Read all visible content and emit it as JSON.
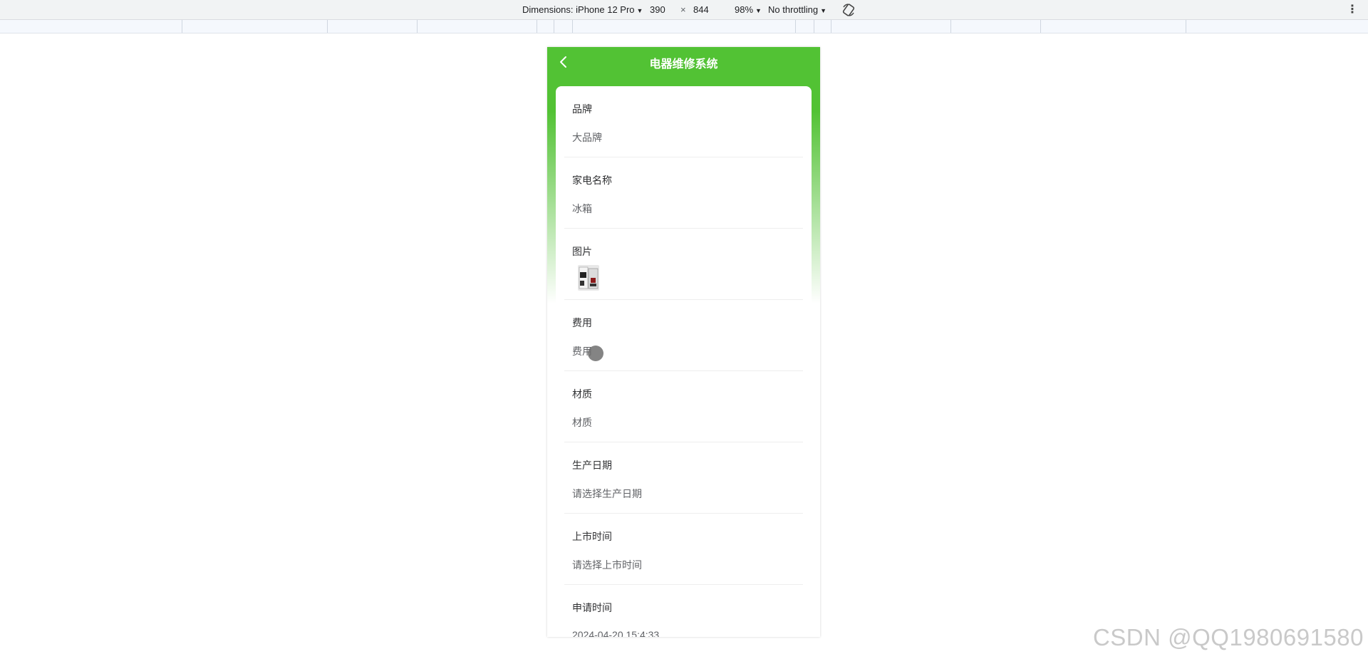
{
  "devtools": {
    "dimensions_label": "Dimensions: iPhone 12 Pro",
    "width": "390",
    "times": "×",
    "height": "844",
    "zoom": "98%",
    "throttling": "No throttling",
    "menu": "⋮"
  },
  "app": {
    "title": "电器维修系统",
    "back_icon": "chevron-left-icon",
    "accent_color": "#52c234"
  },
  "form": {
    "fields": [
      {
        "label": "品牌",
        "value": "大品牌"
      },
      {
        "label": "家电名称",
        "value": "冰箱"
      },
      {
        "label": "图片",
        "value": ""
      },
      {
        "label": "费用",
        "value": "费用"
      },
      {
        "label": "材质",
        "value": "材质"
      },
      {
        "label": "生产日期",
        "value": "请选择生产日期"
      },
      {
        "label": "上市时间",
        "value": "请选择上市时间"
      },
      {
        "label": "申请时间",
        "value": "2024-04-20 15:4:33"
      }
    ]
  },
  "watermark": "CSDN @QQ1980691580"
}
